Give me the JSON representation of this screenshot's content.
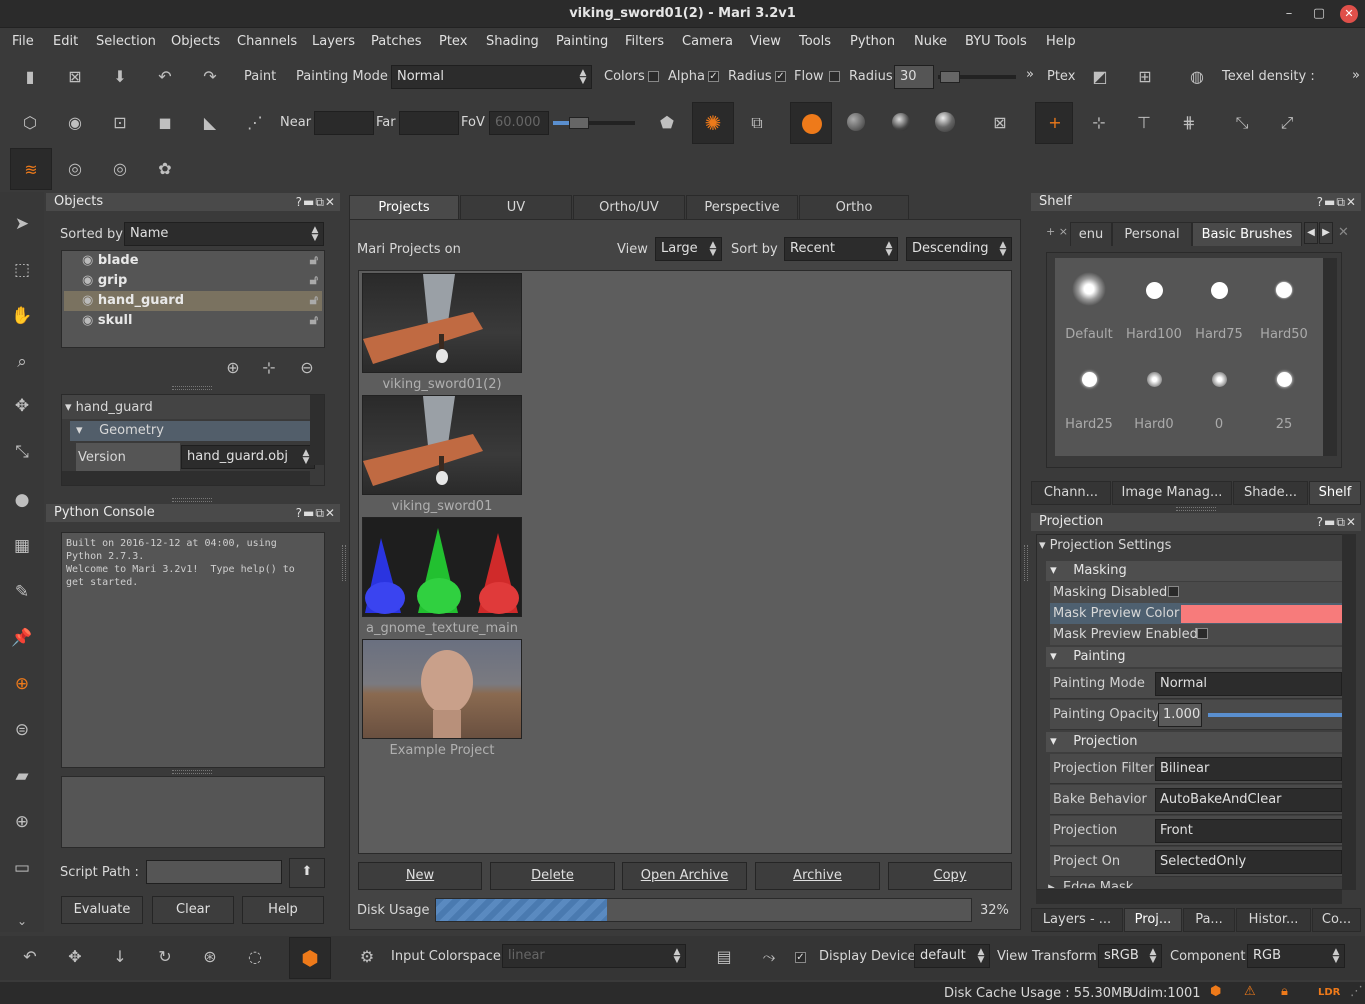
{
  "window": {
    "title": "viking_sword01(2) - Mari 3.2v1"
  },
  "menu": [
    "File",
    "Edit",
    "Selection",
    "Objects",
    "Channels",
    "Layers",
    "Patches",
    "Ptex",
    "Shading",
    "Painting",
    "Filters",
    "Camera",
    "View",
    "Tools",
    "Python",
    "Nuke",
    "BYU Tools",
    "Help"
  ],
  "toolbar1": {
    "paint_label": "Paint",
    "painting_mode_label": "Painting Mode",
    "painting_mode_value": "Normal",
    "colors_label": "Colors",
    "alpha_label": "Alpha",
    "radius_label": "Radius",
    "flow_label": "Flow",
    "radius2_label": "Radius",
    "radius_value": "30",
    "ptex_label": "Ptex",
    "texel_density_label": "Texel density :",
    "more": "»"
  },
  "toolbar2": {
    "near_label": "Near",
    "far_label": "Far",
    "fov_label": "FoV",
    "fov_value": "60.000",
    "orange_color": "#ee7a1a"
  },
  "objects_panel": {
    "title": "Objects",
    "sorted_by_label": "Sorted by",
    "sorted_by_value": "Name",
    "items": [
      "blade",
      "grip",
      "hand_guard",
      "skull"
    ],
    "selected": "hand_guard",
    "info_title": "hand_guard",
    "geometry_label": "Geometry",
    "version_label": "Version",
    "version_value": "hand_guard.obj"
  },
  "python_console": {
    "title": "Python Console",
    "output": "Built on 2016-12-12 at 04:00, using\nPython 2.7.3.\nWelcome to Mari 3.2v1!  Type help() to\nget started.",
    "script_path_label": "Script Path :",
    "evaluate": "Evaluate",
    "clear": "Clear",
    "help": "Help"
  },
  "center": {
    "tabs": [
      "Projects",
      "UV",
      "Ortho/UV",
      "Perspective",
      "Ortho"
    ],
    "active_tab": "Projects",
    "header": "Mari Projects on",
    "view_label": "View",
    "view_value": "Large",
    "sort_by_label": "Sort by",
    "sort_by_value": "Recent",
    "order_value": "Descending",
    "projects": [
      "viking_sword01(2)",
      "viking_sword01",
      "a_gnome_texture_main",
      "Example Project"
    ],
    "buttons": {
      "new": "New",
      "delete": "Delete",
      "open_archive": "Open Archive",
      "archive": "Archive",
      "copy": "Copy"
    },
    "disk_usage_label": "Disk Usage",
    "disk_usage_pct": "32%",
    "disk_usage_fraction": 0.32
  },
  "shelf": {
    "title": "Shelf",
    "tabs": [
      "enu",
      "Personal",
      "Basic Brushes"
    ],
    "active_tab": "Basic Brushes",
    "brushes": [
      "Default",
      "Hard100",
      "Hard75",
      "Hard50",
      "Hard25",
      "Hard0",
      "0",
      "25"
    ]
  },
  "right_tabs1": [
    "Chann...",
    "Image Manag...",
    "Shade...",
    "Shelf"
  ],
  "right_tabs1_active": "Shelf",
  "projection": {
    "title": "Projection",
    "settings_label": "Projection Settings",
    "masking_label": "Masking",
    "masking_disabled_label": "Masking Disabled",
    "mask_preview_color_label": "Mask Preview Color",
    "mask_preview_color": "#f77b7b",
    "mask_preview_enabled_label": "Mask Preview Enabled",
    "painting_label": "Painting",
    "painting_mode_label": "Painting Mode",
    "painting_mode_value": "Normal",
    "painting_opacity_label": "Painting Opacity",
    "painting_opacity_value": "1.000",
    "projection_section_label": "Projection",
    "projection_filter_label": "Projection Filter",
    "projection_filter_value": "Bilinear",
    "bake_behavior_label": "Bake Behavior",
    "bake_behavior_value": "AutoBakeAndClear",
    "projection_label": "Projection",
    "projection_value": "Front",
    "project_on_label": "Project On",
    "project_on_value": "SelectedOnly",
    "edge_mask_label": "Edge Mask"
  },
  "right_tabs2": [
    "Layers - ...",
    "Proj...",
    "Pa...",
    "Histor...",
    "Co..."
  ],
  "right_tabs2_active": "Proj...",
  "bottom_toolbar": {
    "input_colorspace_label": "Input Colorspace",
    "input_colorspace_value": "linear",
    "display_device_label": "Display Device",
    "display_device_value": "default",
    "view_transform_label": "View Transform",
    "view_transform_value": "sRGB",
    "component_label": "Component",
    "component_value": "RGB"
  },
  "status": {
    "disk_cache": "Disk Cache Usage : 55.30MB",
    "udim": "Udim:1001",
    "ldr": "LDR"
  }
}
